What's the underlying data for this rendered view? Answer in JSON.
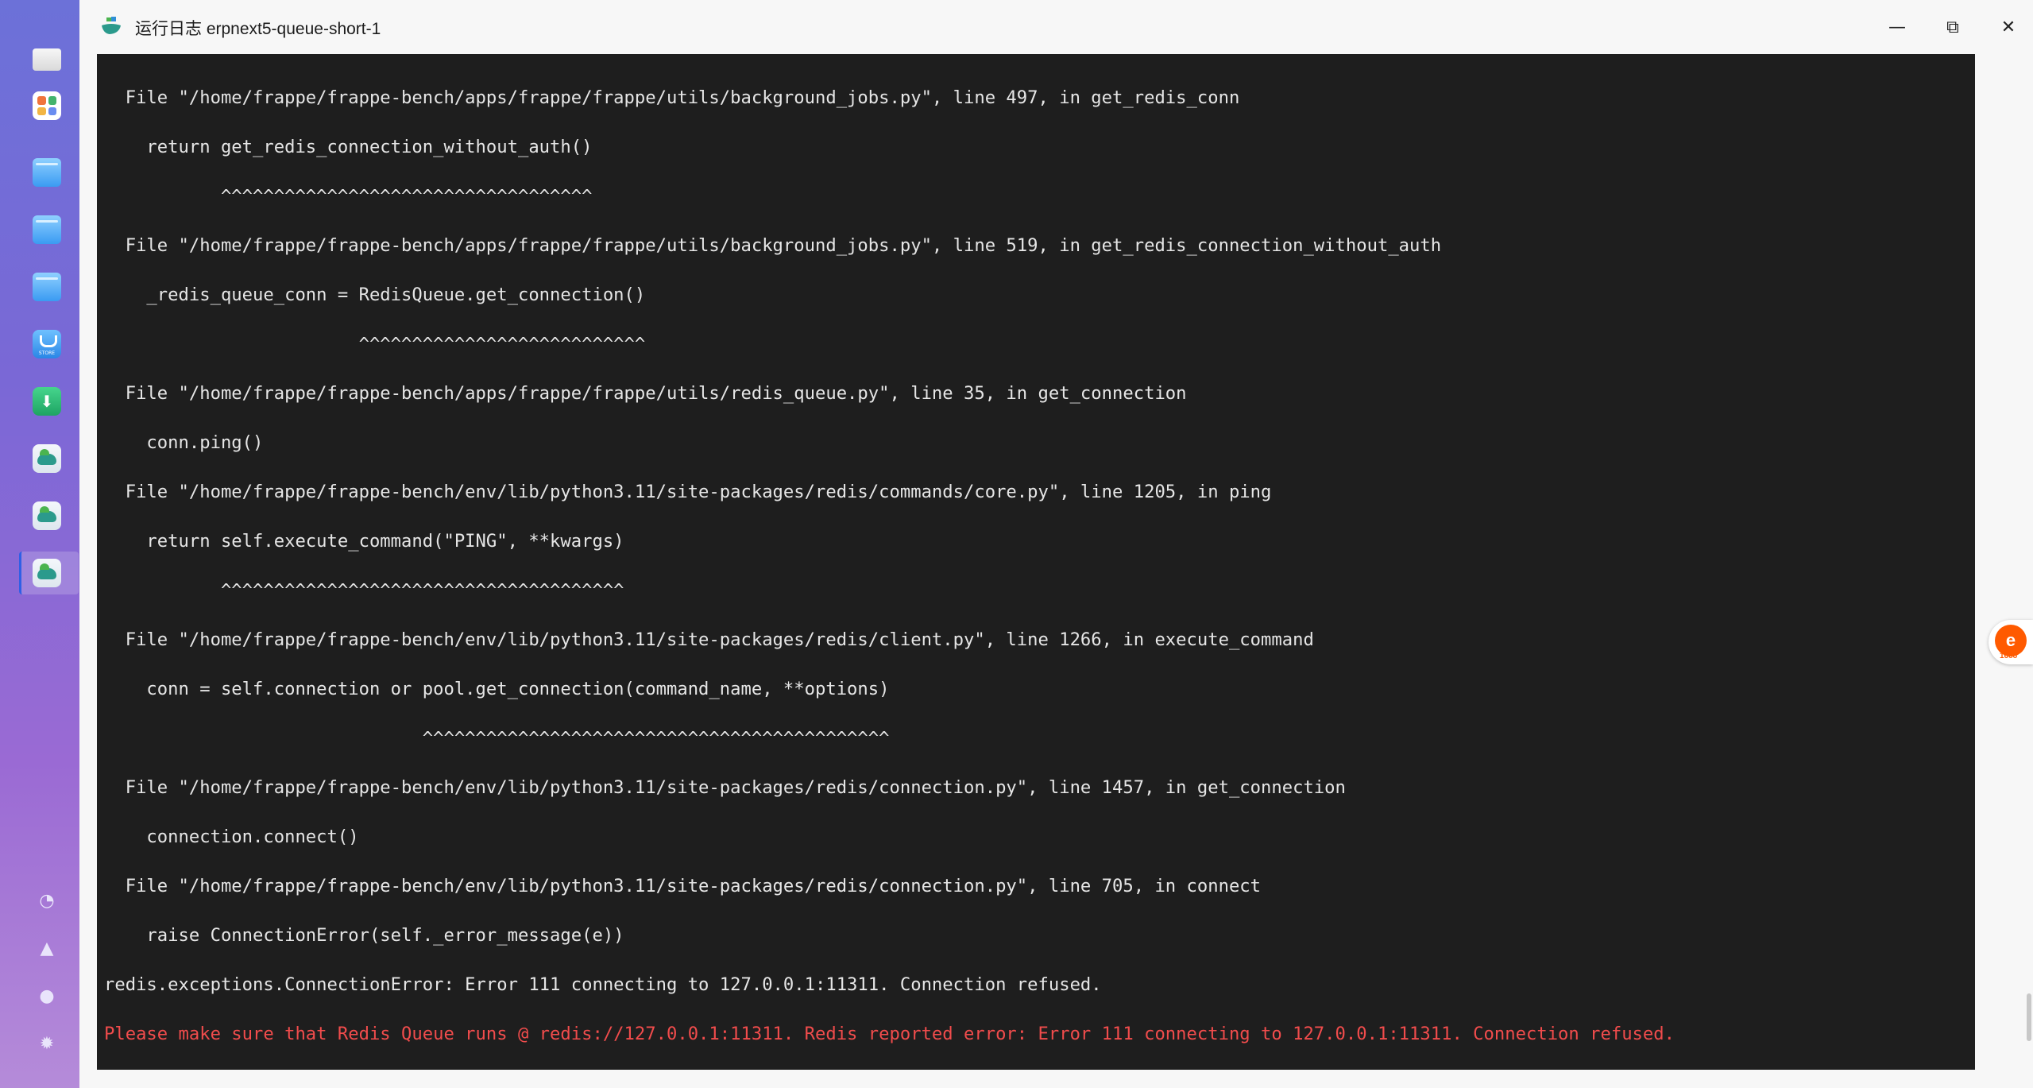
{
  "window": {
    "title": "运行日志 erpnext5-queue-short-1",
    "controls": {
      "minimize": "—",
      "maximize": "⧉",
      "close": "✕"
    }
  },
  "dock": {
    "items": [
      "monitor-icon",
      "apps-icon",
      "folder-icon",
      "folder-icon",
      "folder-icon",
      "store-icon",
      "download-icon",
      "container-icon",
      "container-icon",
      "container-icon"
    ],
    "bottom_items": [
      "help-icon",
      "bell-icon",
      "user-icon",
      "settings-icon"
    ]
  },
  "terminal": {
    "lines": [
      "  File \"/home/frappe/frappe-bench/apps/frappe/frappe/utils/background_jobs.py\", line 497, in get_redis_conn",
      "    return get_redis_connection_without_auth()",
      "           ^^^^^^^^^^^^^^^^^^^^^^^^^^^^^^^^^^^",
      "  File \"/home/frappe/frappe-bench/apps/frappe/frappe/utils/background_jobs.py\", line 519, in get_redis_connection_without_auth",
      "    _redis_queue_conn = RedisQueue.get_connection()",
      "                        ^^^^^^^^^^^^^^^^^^^^^^^^^^^",
      "  File \"/home/frappe/frappe-bench/apps/frappe/frappe/utils/redis_queue.py\", line 35, in get_connection",
      "    conn.ping()",
      "  File \"/home/frappe/frappe-bench/env/lib/python3.11/site-packages/redis/commands/core.py\", line 1205, in ping",
      "    return self.execute_command(\"PING\", **kwargs)",
      "           ^^^^^^^^^^^^^^^^^^^^^^^^^^^^^^^^^^^^^^",
      "  File \"/home/frappe/frappe-bench/env/lib/python3.11/site-packages/redis/client.py\", line 1266, in execute_command",
      "    conn = self.connection or pool.get_connection(command_name, **options)",
      "                              ^^^^^^^^^^^^^^^^^^^^^^^^^^^^^^^^^^^^^^^^^^^^",
      "  File \"/home/frappe/frappe-bench/env/lib/python3.11/site-packages/redis/connection.py\", line 1457, in get_connection",
      "    connection.connect()",
      "  File \"/home/frappe/frappe-bench/env/lib/python3.11/site-packages/redis/connection.py\", line 705, in connect",
      "    raise ConnectionError(self._error_message(e))",
      "redis.exceptions.ConnectionError: Error 111 connecting to 127.0.0.1:11311. Connection refused."
    ],
    "error_line": "Please make sure that Redis Queue runs @ redis://127.0.0.1:11311. Redis reported error: Error 111 connecting to 127.0.0.1:11311. Connection refused."
  },
  "badge": {
    "logo": "e",
    "label": "1688"
  }
}
